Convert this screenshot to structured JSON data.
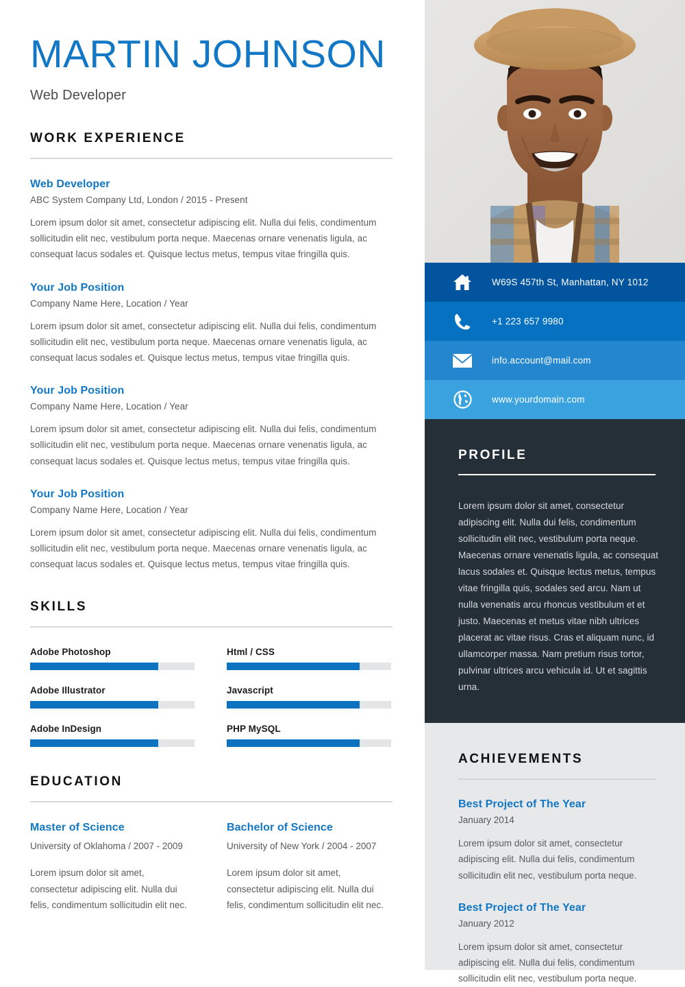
{
  "header": {
    "name": "MARTIN JOHNSON",
    "role": "Web Developer"
  },
  "work": {
    "section_title": "WORK EXPERIENCE",
    "jobs": [
      {
        "title": "Web Developer",
        "meta": "ABC System Company Ltd, London / 2015 - Present",
        "desc": "Lorem ipsum dolor sit amet, consectetur adipiscing elit. Nulla dui felis, condimentum sollicitudin elit nec, vestibulum porta neque. Maecenas ornare venenatis ligula, ac consequat lacus sodales et. Quisque lectus metus, tempus vitae fringilla quis."
      },
      {
        "title": "Your Job Position",
        "meta": "Company Name Here, Location / Year",
        "desc": "Lorem ipsum dolor sit amet, consectetur adipiscing elit. Nulla dui felis, condimentum sollicitudin elit nec, vestibulum porta neque. Maecenas ornare venenatis ligula, ac consequat lacus sodales et. Quisque lectus metus, tempus vitae fringilla quis."
      },
      {
        "title": "Your Job Position",
        "meta": "Company Name Here, Location / Year",
        "desc": "Lorem ipsum dolor sit amet, consectetur adipiscing elit. Nulla dui felis, condimentum sollicitudin elit nec, vestibulum porta neque. Maecenas ornare venenatis ligula, ac consequat lacus sodales et. Quisque lectus metus, tempus vitae fringilla quis."
      },
      {
        "title": "Your Job Position",
        "meta": "Company Name Here, Location / Year",
        "desc": "Lorem ipsum dolor sit amet, consectetur adipiscing elit. Nulla dui felis, condimentum sollicitudin elit nec, vestibulum porta neque. Maecenas ornare venenatis ligula, ac consequat lacus sodales et. Quisque lectus metus, tempus vitae fringilla quis."
      }
    ]
  },
  "skills": {
    "section_title": "SKILLS",
    "items": [
      {
        "name": "Adobe Photoshop",
        "percent": 78
      },
      {
        "name": "Html / CSS",
        "percent": 81
      },
      {
        "name": "Adobe Illustrator",
        "percent": 78
      },
      {
        "name": "Javascript",
        "percent": 81
      },
      {
        "name": "Adobe InDesign",
        "percent": 78
      },
      {
        "name": "PHP MySQL",
        "percent": 81
      }
    ]
  },
  "education": {
    "section_title": "EDUCATION",
    "items": [
      {
        "degree": "Master of Science",
        "meta": "University of Oklahoma / 2007 - 2009",
        "desc": "Lorem ipsum dolor sit amet, consectetur adipiscing elit. Nulla dui felis, condimentum sollicitudin elit nec."
      },
      {
        "degree": "Bachelor of Science",
        "meta": "University of New York / 2004 - 2007",
        "desc": "Lorem ipsum dolor sit amet, consectetur adipiscing elit. Nulla dui felis, condimentum sollicitudin elit nec."
      }
    ]
  },
  "contact": {
    "rows": [
      {
        "icon": "home-icon",
        "text": "W69S 457th St, Manhattan, NY 1012",
        "color": "#03549f"
      },
      {
        "icon": "phone-icon",
        "text": "+1 223 657 9980",
        "color": "#0671c0"
      },
      {
        "icon": "mail-icon",
        "text": "info.account@mail.com",
        "color": "#2386ce"
      },
      {
        "icon": "globe-icon",
        "text": "www.yourdomain.com",
        "color": "#3aa3df"
      }
    ]
  },
  "profile": {
    "section_title": "PROFILE",
    "text": "Lorem ipsum dolor sit amet, consectetur adipiscing elit. Nulla dui felis, condimentum sollicitudin elit nec, vestibulum porta neque. Maecenas ornare venenatis ligula, ac consequat lacus sodales et. Quisque lectus metus, tempus vitae fringilla quis, sodales sed arcu. Nam ut nulla venenatis arcu rhoncus vestibulum et et justo. Maecenas et metus vitae nibh ultrices placerat ac vitae risus. Cras et aliquam nunc, id ullamcorper massa. Nam pretium risus tortor, pulvinar ultrices arcu vehicula id. Ut et sagittis urna."
  },
  "achievements": {
    "section_title": "ACHIEVEMENTS",
    "items": [
      {
        "name": "Best Project of The Year",
        "date": "January 2014",
        "desc": "Lorem ipsum dolor sit amet, consectetur adipiscing elit. Nulla dui felis, condimentum sollicitudin elit nec, vestibulum porta neque."
      },
      {
        "name": "Best Project of The Year",
        "date": "January 2012",
        "desc": "Lorem ipsum dolor sit amet, consectetur adipiscing elit. Nulla dui felis, condimentum sollicitudin elit nec, vestibulum porta neque."
      }
    ]
  },
  "theme": {
    "accent_blue": "#1277c4",
    "bar_blue": "#0d72c0",
    "dark_panel": "#252f38",
    "light_panel": "#e6e8e9"
  }
}
